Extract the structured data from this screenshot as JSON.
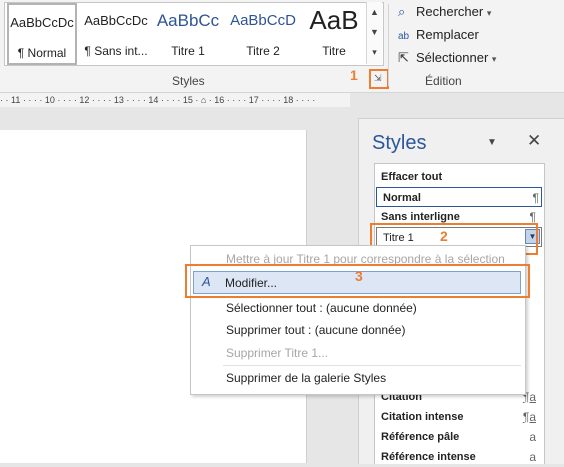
{
  "ribbon": {
    "styles_gallery": [
      {
        "preview": "AaBbCcDc",
        "name": "¶ Normal",
        "selected": true
      },
      {
        "preview": "AaBbCcDc",
        "name": "¶ Sans int..."
      },
      {
        "preview": "AaBbCc",
        "name": "Titre 1"
      },
      {
        "preview": "AaBbCcD",
        "name": "Titre 2"
      },
      {
        "preview": "AaB",
        "name": "Titre"
      }
    ],
    "styles_group_label": "Styles",
    "edition": {
      "rechercher": "Rechercher",
      "remplacer": "Remplacer",
      "selectionner": "Sélectionner",
      "group_label": "Édition"
    }
  },
  "ruler": {
    "text": "· · 11 · · · · 10 · · · · 12 · · · · 13 · · · · 14 · · · · 15 · ⌂ · 16 · · · · 17 · · · · 18 · · · ·"
  },
  "annotations": {
    "n1": "1",
    "n2": "2",
    "n3": "3"
  },
  "styles_pane": {
    "title": "Styles",
    "items": [
      {
        "label": "Effacer tout",
        "mark": ""
      },
      {
        "label": "Normal",
        "mark": "¶"
      },
      {
        "label": "Sans interligne",
        "mark": "¶"
      },
      {
        "label": "Titre 1",
        "mark": "▼"
      },
      {
        "label": "Citation",
        "mark": "¶a"
      },
      {
        "label": "Citation intense",
        "mark": "¶a"
      },
      {
        "label": "Référence pâle",
        "mark": "a"
      },
      {
        "label": "Référence intense",
        "mark": "a"
      }
    ]
  },
  "context_menu": {
    "update": "Mettre à jour Titre 1 pour correspondre à la sélection",
    "modify": "Modifier...",
    "select_all": "Sélectionner tout : (aucune donnée)",
    "delete_all": "Supprimer tout : (aucune donnée)",
    "delete_style": "Supprimer Titre 1...",
    "remove_gallery": "Supprimer de la galerie Styles"
  },
  "colors": {
    "accent": "#2b579a",
    "annotation": "#ed7d31"
  }
}
